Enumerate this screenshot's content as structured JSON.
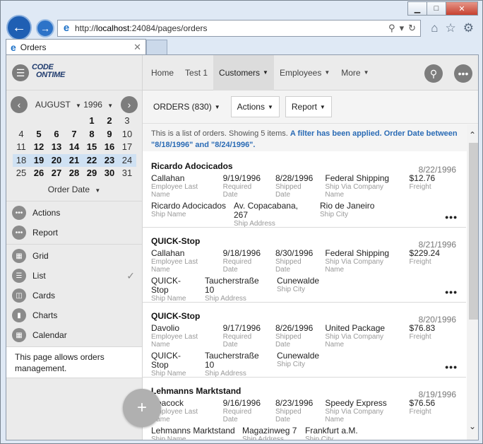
{
  "browser": {
    "url_prefix": "http://",
    "url_host": "localhost",
    "url_rest": ":24084/pages/orders",
    "tab_title": "Orders",
    "window_buttons": {
      "minimize": "▁",
      "maximize": "□",
      "close": "✕"
    }
  },
  "sidebar": {
    "logo_line1": "CODE",
    "logo_line2": "ONTIME",
    "calendar": {
      "month": "AUGUST",
      "year": "1996",
      "days": [
        {
          "n": "",
          "b": false,
          "s": false
        },
        {
          "n": "",
          "b": false,
          "s": false
        },
        {
          "n": "",
          "b": false,
          "s": false
        },
        {
          "n": "",
          "b": false,
          "s": false
        },
        {
          "n": "1",
          "b": true,
          "s": false
        },
        {
          "n": "2",
          "b": true,
          "s": false
        },
        {
          "n": "3",
          "b": false,
          "s": false
        },
        {
          "n": "4",
          "b": false,
          "s": false
        },
        {
          "n": "5",
          "b": true,
          "s": false
        },
        {
          "n": "6",
          "b": true,
          "s": false
        },
        {
          "n": "7",
          "b": true,
          "s": false
        },
        {
          "n": "8",
          "b": true,
          "s": false
        },
        {
          "n": "9",
          "b": true,
          "s": false
        },
        {
          "n": "10",
          "b": false,
          "s": false
        },
        {
          "n": "11",
          "b": false,
          "s": false
        },
        {
          "n": "12",
          "b": true,
          "s": false
        },
        {
          "n": "13",
          "b": true,
          "s": false
        },
        {
          "n": "14",
          "b": true,
          "s": false
        },
        {
          "n": "15",
          "b": true,
          "s": false
        },
        {
          "n": "16",
          "b": true,
          "s": false
        },
        {
          "n": "17",
          "b": false,
          "s": false
        },
        {
          "n": "18",
          "b": false,
          "s": true
        },
        {
          "n": "19",
          "b": true,
          "s": true
        },
        {
          "n": "20",
          "b": true,
          "s": true
        },
        {
          "n": "21",
          "b": true,
          "s": true
        },
        {
          "n": "22",
          "b": true,
          "s": true
        },
        {
          "n": "23",
          "b": true,
          "s": true
        },
        {
          "n": "24",
          "b": false,
          "s": true
        },
        {
          "n": "25",
          "b": false,
          "s": false
        },
        {
          "n": "26",
          "b": true,
          "s": false
        },
        {
          "n": "27",
          "b": true,
          "s": false
        },
        {
          "n": "28",
          "b": true,
          "s": false
        },
        {
          "n": "29",
          "b": true,
          "s": false
        },
        {
          "n": "30",
          "b": true,
          "s": false
        },
        {
          "n": "31",
          "b": false,
          "s": false
        }
      ],
      "footer": "Order Date"
    },
    "actions": [
      "Actions",
      "Report"
    ],
    "views": [
      {
        "label": "Grid",
        "icon": "grid-icon",
        "checked": false
      },
      {
        "label": "List",
        "icon": "list-icon",
        "checked": true
      },
      {
        "label": "Cards",
        "icon": "cards-icon",
        "checked": false
      },
      {
        "label": "Charts",
        "icon": "charts-icon",
        "checked": false
      },
      {
        "label": "Calendar",
        "icon": "calendar-icon",
        "checked": false
      }
    ],
    "description": "This page allows orders management."
  },
  "menu": [
    "Home",
    "Test 1",
    "Customers",
    "Employees",
    "More"
  ],
  "toolbar": {
    "view": "ORDERS (830)",
    "actions": "Actions",
    "report": "Report"
  },
  "info": {
    "text": "This is a list of orders. Showing 5 items.",
    "filter": "A filter has been applied. Order Date between \"8/18/1996\" and \"8/24/1996\"."
  },
  "labels": {
    "employee": "Employee Last Name",
    "required": "Required Date",
    "shipped": "Shipped Date",
    "company": "Ship Via Company Name",
    "freight": "Freight",
    "ship_name": "Ship Name",
    "ship_address": "Ship Address",
    "ship_city": "Ship City"
  },
  "orders": [
    {
      "customer": "Ricardo Adocicados",
      "order_date": "8/22/1996",
      "employee": "Callahan",
      "required": "9/19/1996",
      "shipped": "8/28/1996",
      "company": "Federal Shipping",
      "freight": "$12.76",
      "ship_name": "Ricardo Adocicados",
      "ship_address": "Av. Copacabana, 267",
      "ship_city": "Rio de Janeiro"
    },
    {
      "customer": "QUICK-Stop",
      "order_date": "8/21/1996",
      "employee": "Callahan",
      "required": "9/18/1996",
      "shipped": "8/30/1996",
      "company": "Federal Shipping",
      "freight": "$229.24",
      "ship_name": "QUICK-Stop",
      "ship_address": "Taucherstraße 10",
      "ship_city": "Cunewalde"
    },
    {
      "customer": "QUICK-Stop",
      "order_date": "8/20/1996",
      "employee": "Davolio",
      "required": "9/17/1996",
      "shipped": "8/26/1996",
      "company": "United Package",
      "freight": "$76.83",
      "ship_name": "QUICK-Stop",
      "ship_address": "Taucherstraße 10",
      "ship_city": "Cunewalde"
    },
    {
      "customer": "Lehmanns Marktstand",
      "order_date": "8/19/1996",
      "employee": "Peacock",
      "required": "9/16/1996",
      "shipped": "8/23/1996",
      "company": "Speedy Express",
      "freight": "$76.56",
      "ship_name": "Lehmanns Marktstand",
      "ship_address": "Magazinweg 7",
      "ship_city": "Frankfurt a.M."
    }
  ]
}
